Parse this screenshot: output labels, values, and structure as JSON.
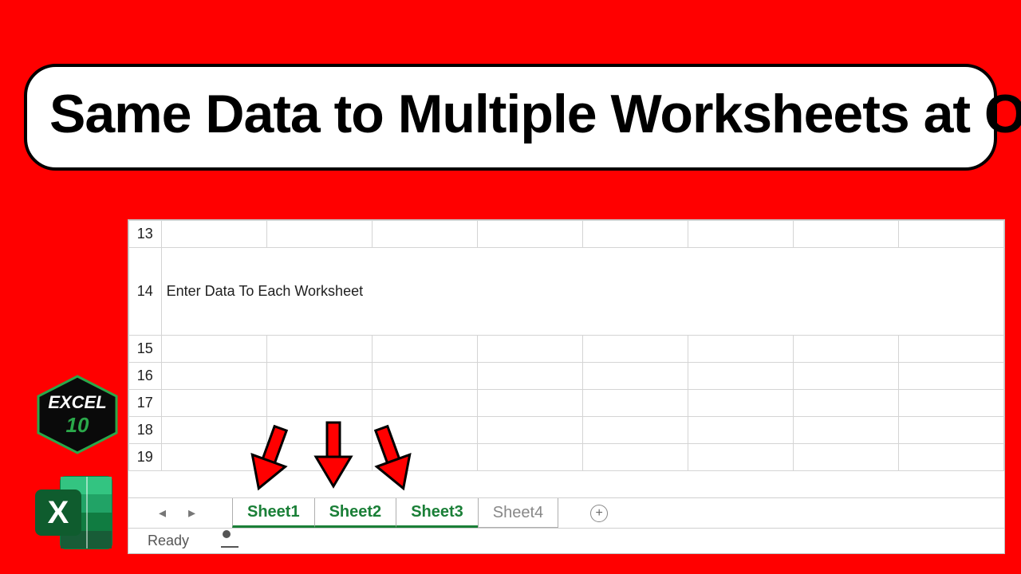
{
  "title": "Same Data to Multiple Worksheets at Once",
  "cell_text": "Enter Data To Each Worksheet",
  "rows": [
    "13",
    "14",
    "15",
    "16",
    "17",
    "18",
    "19"
  ],
  "tabs": [
    {
      "label": "Sheet1",
      "selected": true
    },
    {
      "label": "Sheet2",
      "selected": true
    },
    {
      "label": "Sheet3",
      "selected": true
    },
    {
      "label": "Sheet4",
      "selected": false
    }
  ],
  "status": "Ready",
  "logos": {
    "hex_top": "EXCEL",
    "hex_bottom": "10",
    "ms_excel_letter": "X"
  },
  "colors": {
    "background": "#ff0000",
    "excel_green": "#1a7f37",
    "ms_excel_dark": "#0f5c2e",
    "ms_excel_light": "#21a366"
  }
}
